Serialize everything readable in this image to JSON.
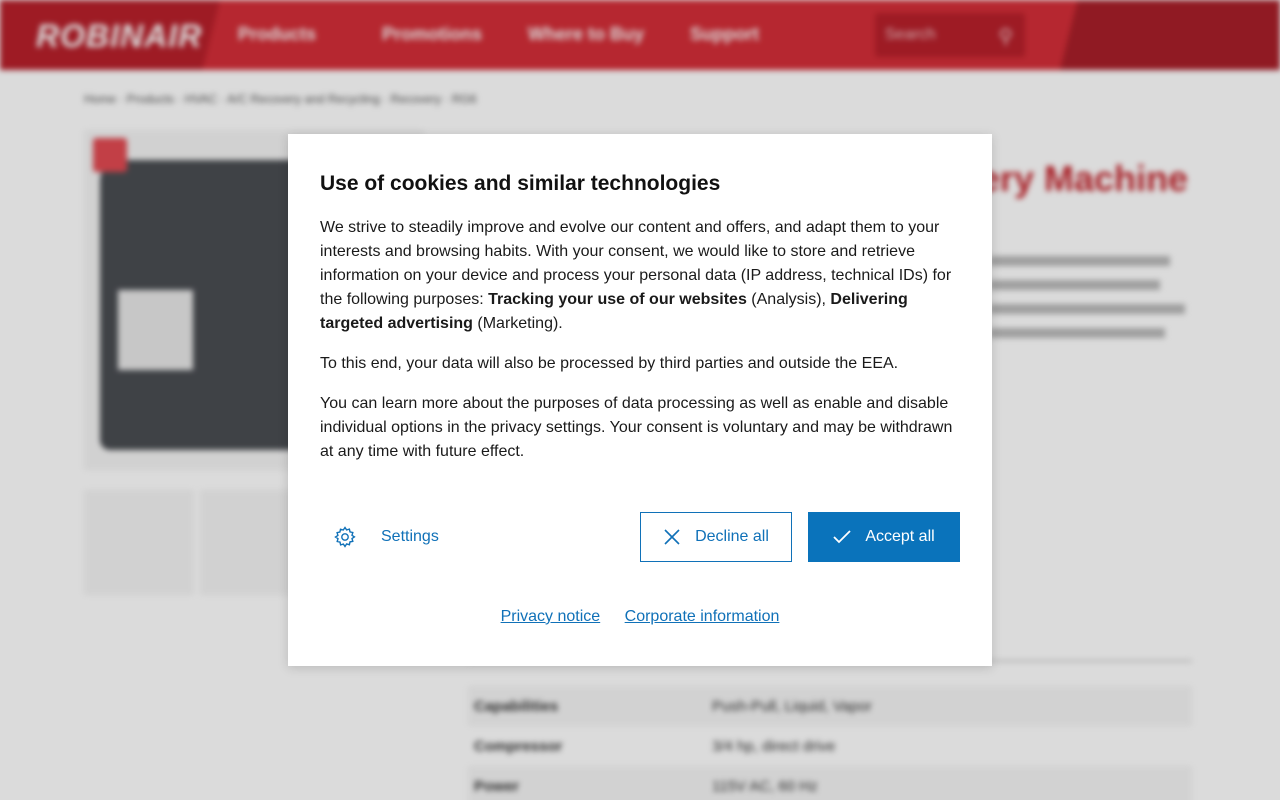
{
  "header": {
    "logo": "ROBINAIR",
    "nav": [
      "Products",
      "Promotions",
      "Where to Buy",
      "Support"
    ],
    "search_placeholder": "Search"
  },
  "breadcrumb": "Home · Products · HVAC · A/C Recovery and Recycling · Recovery · RG6",
  "product": {
    "title": "ery Machine",
    "specs": [
      {
        "key": "Capabilities",
        "value": "Push-Pull, Liquid, Vapor"
      },
      {
        "key": "Compressor",
        "value": "3/4 hp, direct drive"
      },
      {
        "key": "Power",
        "value": "115V AC, 60 Hz"
      }
    ]
  },
  "cookie": {
    "title": "Use of cookies and similar technologies",
    "p1_before": "We strive to steadily improve and evolve our content and offers, and adapt them to your interests and browsing habits. With your consent, we would like to store and retrieve information on your device and process your personal data (IP address, technical IDs) for the following purposes: ",
    "p1_bold1": "Tracking your use of our websites",
    "p1_mid": " (Analysis), ",
    "p1_bold2": "Delivering targeted advertising",
    "p1_after": " (Marketing).",
    "p2": "To this end, your data will also be processed by third parties and outside the EEA.",
    "p3": "You can learn more about the purposes of data processing as well as enable and disable individual options in the privacy settings. Your consent is voluntary and may be withdrawn at any time with future effect.",
    "settings_label": "Settings",
    "decline_label": "Decline all",
    "accept_label": "Accept all",
    "privacy_link": "Privacy notice",
    "corporate_link": "Corporate information"
  },
  "colors": {
    "brand_red": "#d42e38",
    "accent_blue": "#0a73bb"
  }
}
